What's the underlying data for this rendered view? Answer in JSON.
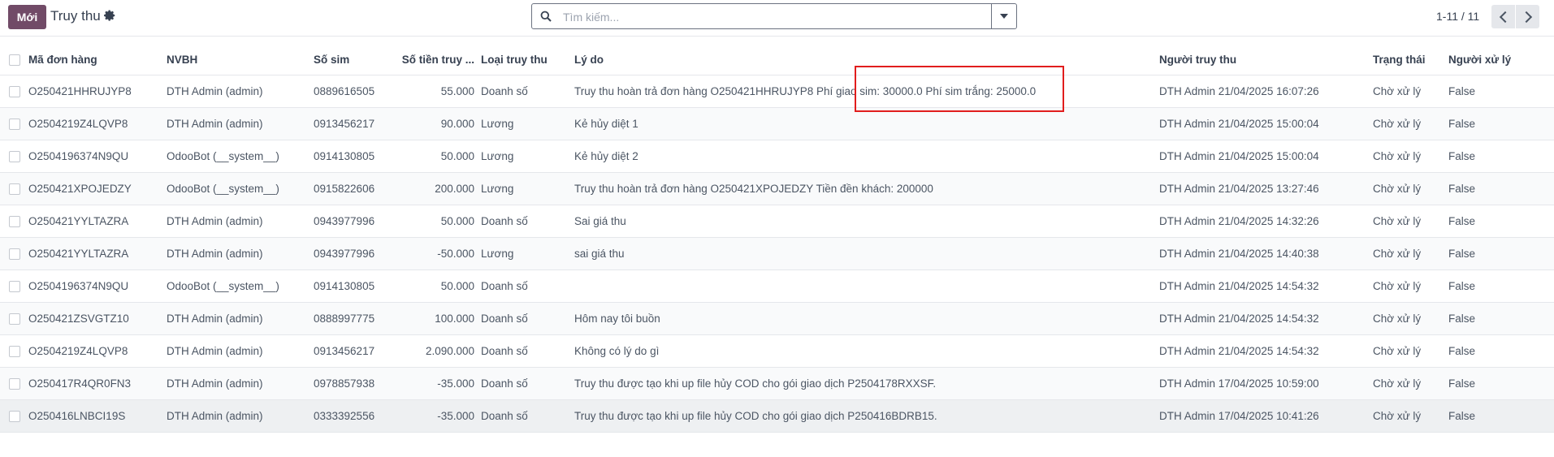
{
  "header": {
    "new_button": "Mới",
    "title": "Truy thu",
    "search_placeholder": "Tìm kiếm...",
    "pager": "1-11 / 11"
  },
  "table": {
    "columns": [
      "Mã đơn hàng",
      "NVBH",
      "Số sim",
      "Số tiền truy ...",
      "Loại truy thu",
      "Lý do",
      "Người truy thu",
      "Trạng thái",
      "Người xử lý"
    ],
    "rows": [
      [
        "O250421HHRUJYP8",
        "DTH Admin (admin)",
        "0889616505",
        "55.000",
        "Doanh số",
        "Truy thu hoàn trả đơn hàng O250421HHRUJYP8 Phí giao sim: 30000.0 Phí sim trắng: 25000.0",
        "DTH Admin 21/04/2025 16:07:26",
        "Chờ xử lý",
        "False"
      ],
      [
        "O2504219Z4LQVP8",
        "DTH Admin (admin)",
        "0913456217",
        "90.000",
        "Lương",
        "Kẻ hủy diệt 1",
        "DTH Admin 21/04/2025 15:00:04",
        "Chờ xử lý",
        "False"
      ],
      [
        "O2504196374N9QU",
        "OdooBot (__system__)",
        "0914130805",
        "50.000",
        "Lương",
        "Kẻ hủy diệt 2",
        "DTH Admin 21/04/2025 15:00:04",
        "Chờ xử lý",
        "False"
      ],
      [
        "O250421XPOJEDZY",
        "OdooBot (__system__)",
        "0915822606",
        "200.000",
        "Lương",
        "Truy thu hoàn trả đơn hàng O250421XPOJEDZY Tiền đền khách: 200000",
        "DTH Admin 21/04/2025 13:27:46",
        "Chờ xử lý",
        "False"
      ],
      [
        "O250421YYLTAZRA",
        "DTH Admin (admin)",
        "0943977996",
        "50.000",
        "Doanh số",
        "Sai giá thu",
        "DTH Admin 21/04/2025 14:32:26",
        "Chờ xử lý",
        "False"
      ],
      [
        "O250421YYLTAZRA",
        "DTH Admin (admin)",
        "0943977996",
        "-50.000",
        "Lương",
        "sai giá thu",
        "DTH Admin 21/04/2025 14:40:38",
        "Chờ xử lý",
        "False"
      ],
      [
        "O2504196374N9QU",
        "OdooBot (__system__)",
        "0914130805",
        "50.000",
        "Doanh số",
        "",
        "DTH Admin 21/04/2025 14:54:32",
        "Chờ xử lý",
        "False"
      ],
      [
        "O250421ZSVGTZ10",
        "DTH Admin (admin)",
        "0888997775",
        "100.000",
        "Doanh số",
        "Hôm nay tôi buồn",
        "DTH Admin 21/04/2025 14:54:32",
        "Chờ xử lý",
        "False"
      ],
      [
        "O2504219Z4LQVP8",
        "DTH Admin (admin)",
        "0913456217",
        "2.090.000",
        "Doanh số",
        "Không có lý do gì",
        "DTH Admin 21/04/2025 14:54:32",
        "Chờ xử lý",
        "False"
      ],
      [
        "O250417R4QR0FN3",
        "DTH Admin (admin)",
        "0978857938",
        "-35.000",
        "Doanh số",
        "Truy thu được tạo khi up file hủy COD cho gói giao dịch P2504178RXXSF.",
        "DTH Admin 17/04/2025 10:59:00",
        "Chờ xử lý",
        "False"
      ],
      [
        "O250416LNBCI19S",
        "DTH Admin (admin)",
        "0333392556",
        "-35.000",
        "Doanh số",
        "Truy thu được tạo khi up file hủy COD cho gói giao dịch P250416BDRB15.",
        "DTH Admin 17/04/2025 10:41:26",
        "Chờ xử lý",
        "False"
      ]
    ]
  },
  "colors": {
    "brand": "#714b67",
    "highlight": "#e11d1d"
  }
}
